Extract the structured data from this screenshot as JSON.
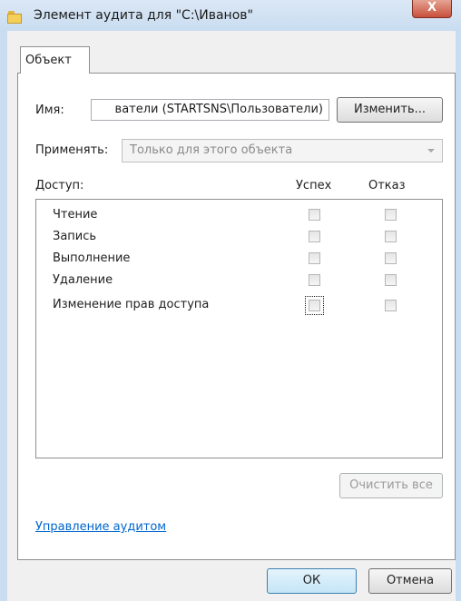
{
  "window": {
    "title": "Элемент аудита для \"C:\\Иванов\"",
    "close_symbol": "X",
    "icon": "folder-icon"
  },
  "tabs": [
    {
      "label": "Объект"
    }
  ],
  "name_row": {
    "label": "Имя:",
    "value": "ватели (STARTSNS\\Пользователи)",
    "change_button": "Изменить..."
  },
  "apply_row": {
    "label": "Применять:",
    "selected": "Только для этого объекта"
  },
  "access": {
    "label": "Доступ:",
    "columns": [
      "Успех",
      "Отказ"
    ],
    "rows": [
      {
        "label": "Чтение",
        "success": false,
        "failure": false
      },
      {
        "label": "Запись",
        "success": false,
        "failure": false
      },
      {
        "label": "Выполнение",
        "success": false,
        "failure": false
      },
      {
        "label": "Удаление",
        "success": false,
        "failure": false
      },
      {
        "label": "Изменение прав доступа",
        "success": false,
        "failure": false
      }
    ]
  },
  "clear_button": "Очистить все",
  "manage_link": "Управление аудитом",
  "footer": {
    "ok": "ОК",
    "cancel": "Отмена"
  }
}
